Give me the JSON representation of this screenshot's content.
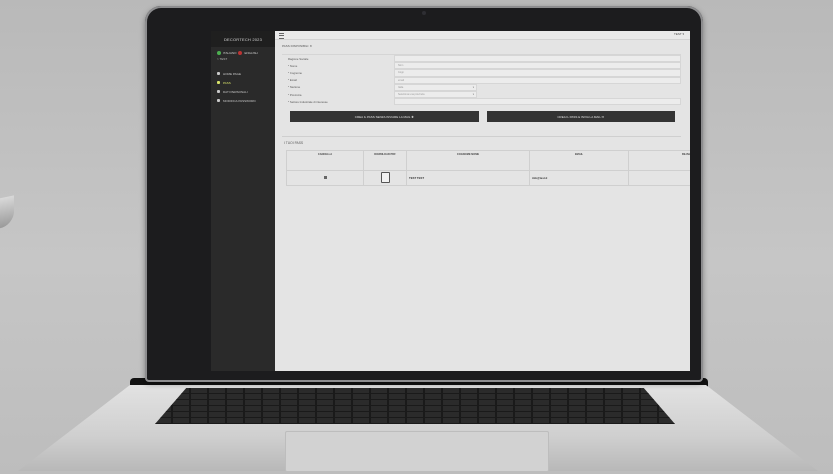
{
  "sidebar": {
    "brand": "DECORTECH 2023",
    "languages": [
      "ITALIANO",
      "ENGLISH"
    ],
    "user": "> TEST",
    "items": [
      {
        "label": "HOME PAGE",
        "icon": "home-icon",
        "active": false
      },
      {
        "label": "PASS",
        "icon": "ticket-icon",
        "active": true
      },
      {
        "label": "DATI PERSONALI",
        "icon": "user-icon",
        "active": false
      },
      {
        "label": "MODIFICA PASSWORD",
        "icon": "key-icon",
        "active": false
      }
    ],
    "active_color": "#d7e36a"
  },
  "topbar": {
    "user_menu": "TEST ▾"
  },
  "main": {
    "available_passes": "PASS DISPONIBILI: 8",
    "form": {
      "rows": [
        {
          "label": "Ragione Sociale",
          "value": ""
        },
        {
          "label": "* Nome",
          "value": "Nom"
        },
        {
          "label": "* Cognome",
          "value": "Cogn"
        },
        {
          "label": "* Email",
          "value": "email"
        },
        {
          "label": "* Nazione",
          "value": "Italia"
        },
        {
          "label": "* Provincia",
          "value": "Seleziona una provincia"
        },
        {
          "label": "* Settore Industriale di interesse",
          "value": ""
        }
      ]
    },
    "buttons": {
      "create_without_mail": "CREA IL PASS SENZA INVIARE LA MAIL ✚",
      "create_and_mail": "CREA IL PASS E INVIA LA MAIL ✉"
    },
    "passes": {
      "title": "I TUOI PASS",
      "headers": [
        "CANCELLA",
        "DOWNLOAD PDF",
        "COGNOME NOME",
        "EMAIL",
        "RE-INVIO EMAIL"
      ],
      "rows": [
        {
          "name": "TEST TEST",
          "email": "info@test.it",
          "resend": "✉"
        }
      ]
    }
  }
}
